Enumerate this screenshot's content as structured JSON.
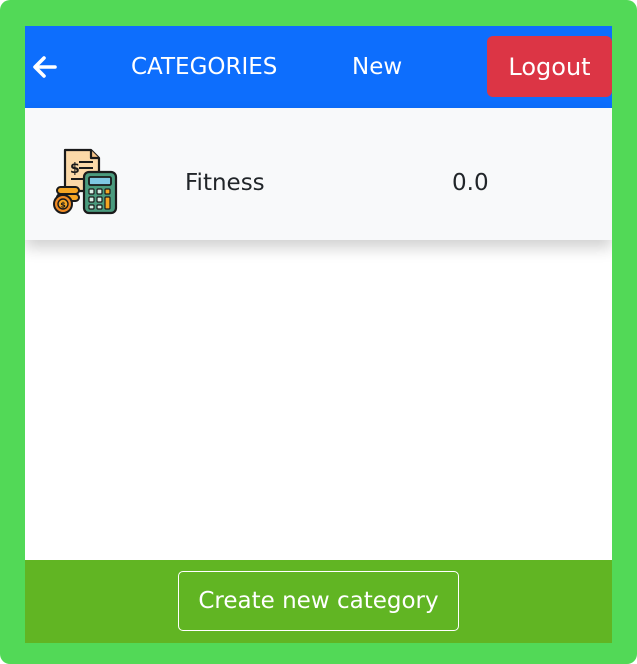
{
  "header": {
    "back_icon": "arrow-left-icon",
    "categories_label": "CATEGORIES",
    "new_label": "New",
    "logout_label": "Logout",
    "colors": {
      "bar": "#0d6efd",
      "logout": "#dc3545"
    }
  },
  "categories": [
    {
      "icon": "budget-calculator-icon",
      "name": "Fitness",
      "amount": "0.0"
    }
  ],
  "footer": {
    "create_label": "Create new category",
    "color": "#61b523"
  },
  "frame_color": "#52d957"
}
